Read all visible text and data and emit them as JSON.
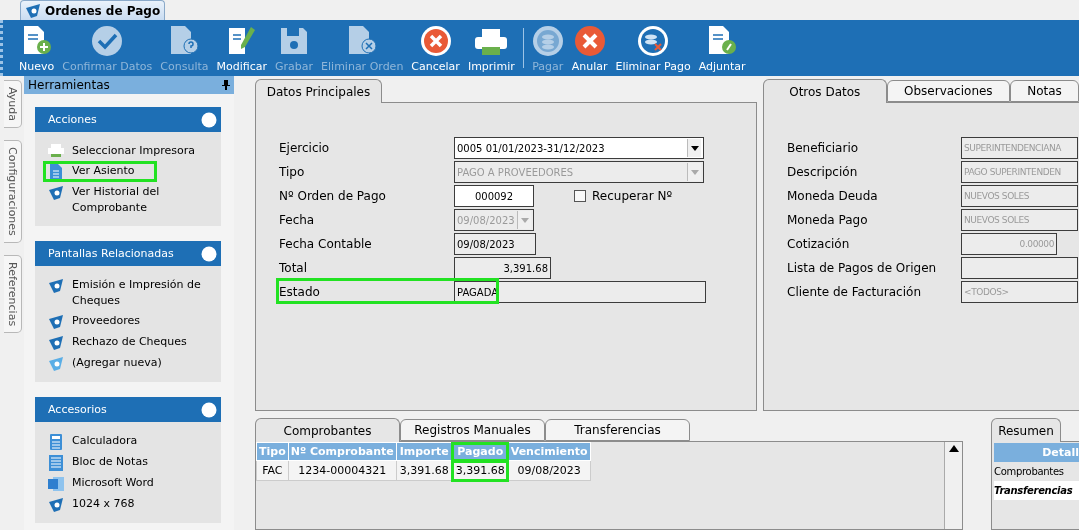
{
  "window_tab": {
    "title": "Ordenes de Pago"
  },
  "toolbar": [
    {
      "label": "Nuevo",
      "disabled": false
    },
    {
      "label": "Confirmar Datos",
      "disabled": true
    },
    {
      "label": "Consulta",
      "disabled": true
    },
    {
      "label": "Modificar",
      "disabled": false
    },
    {
      "label": "Grabar",
      "disabled": true
    },
    {
      "label": "Eliminar Orden",
      "disabled": true
    },
    {
      "label": "Cancelar",
      "disabled": false
    },
    {
      "label": "Imprimir",
      "disabled": false
    },
    {
      "label": "Pagar",
      "disabled": true
    },
    {
      "label": "Anular",
      "disabled": false
    },
    {
      "label": "Eliminar Pago",
      "disabled": false
    },
    {
      "label": "Adjuntar",
      "disabled": false
    }
  ],
  "side_tabs": [
    "Ayuda",
    "Configuraciones",
    "Referencias"
  ],
  "tools_panel": {
    "title": "Herramientas",
    "groups": [
      {
        "title": "Acciones",
        "items": [
          {
            "label": "Seleccionar Impresora",
            "highlighted": false
          },
          {
            "label": "Ver Asiento",
            "highlighted": true
          },
          {
            "label": "Ver Historial del Comprobante",
            "highlighted": false
          }
        ]
      },
      {
        "title": "Pantallas Relacionadas",
        "items": [
          {
            "label": "Emisión e Impresión de Cheques",
            "highlighted": false
          },
          {
            "label": "Proveedores",
            "highlighted": false
          },
          {
            "label": "Rechazo de Cheques",
            "highlighted": false
          },
          {
            "label": "(Agregar nueva)",
            "highlighted": false
          }
        ]
      },
      {
        "title": "Accesorios",
        "items": [
          {
            "label": "Calculadora",
            "highlighted": false
          },
          {
            "label": "Bloc de Notas",
            "highlighted": false
          },
          {
            "label": "Microsoft Word",
            "highlighted": false
          },
          {
            "label": "1024 x 768",
            "highlighted": false
          }
        ]
      }
    ]
  },
  "main_tabs": [
    {
      "label": "Datos Principales",
      "selected": true
    }
  ],
  "main_fields": [
    {
      "label": "Ejercicio",
      "value": "0005 01/01/2023-31/12/2023",
      "kind": "dropdown",
      "disabled": false,
      "highlighted": false
    },
    {
      "label": "Tipo",
      "value": "PAGO A PROVEEDORES",
      "kind": "dropdown",
      "disabled": true,
      "highlighted": false
    },
    {
      "label": "Nº Orden de Pago",
      "value": "000092",
      "kind": "number",
      "disabled": false,
      "highlighted": false
    },
    {
      "label": "Fecha",
      "value": "09/08/2023",
      "kind": "dropdown",
      "disabled": true,
      "highlighted": false
    },
    {
      "label": "Fecha Contable",
      "value": "09/08/2023",
      "kind": "text",
      "disabled": false,
      "highlighted": false
    },
    {
      "label": "Total",
      "value": "3,391.68",
      "kind": "amount",
      "disabled": false,
      "highlighted": false
    },
    {
      "label": "Estado",
      "value": "PAGADA",
      "kind": "text",
      "disabled": false,
      "highlighted": true
    }
  ],
  "recover_checkbox": {
    "label": "Recuperar Nº",
    "checked": false
  },
  "other_tabs": [
    {
      "label": "Otros Datos",
      "selected": true
    },
    {
      "label": "Observaciones",
      "selected": false
    },
    {
      "label": "Notas",
      "selected": false
    }
  ],
  "other_fields": [
    {
      "label": "Beneficiario",
      "value": "SUPERINTENDENCIANA",
      "kind": "text"
    },
    {
      "label": "Descripción",
      "value": "PAGO SUPERINTENDEN",
      "kind": "text"
    },
    {
      "label": "Moneda Deuda",
      "value": "NUEVOS SOLES",
      "kind": "text"
    },
    {
      "label": "Moneda Pago",
      "value": "NUEVOS SOLES",
      "kind": "text"
    },
    {
      "label": "Cotización",
      "value": "0.00000",
      "kind": "amount"
    },
    {
      "label": "Lista de Pagos de Origen",
      "kind": "text"
    },
    {
      "label": "Cliente de Facturación",
      "value": "<TODOS>",
      "kind": "text"
    }
  ],
  "bottom_tabs": [
    {
      "label": "Comprobantes",
      "selected": true
    },
    {
      "label": "Registros Manuales",
      "selected": false
    },
    {
      "label": "Transferencias",
      "selected": false
    }
  ],
  "table": {
    "columns": [
      {
        "label": "Tipo",
        "highlighted": false
      },
      {
        "label": "Nº Comprobante",
        "highlighted": false
      },
      {
        "label": "Importe",
        "highlighted": false
      },
      {
        "label": "Pagado",
        "highlighted": true
      },
      {
        "label": "Vencimiento",
        "highlighted": false
      }
    ],
    "rows": [
      [
        "FAC",
        "1234-00004321",
        "3,391.68",
        "3,391.68",
        "09/08/2023"
      ]
    ]
  },
  "summary": {
    "tab": "Resumen",
    "header": "Detall",
    "rows": [
      {
        "label": "Comprobantes",
        "selected": false
      },
      {
        "label": "Transferencias",
        "selected": true
      }
    ]
  }
}
